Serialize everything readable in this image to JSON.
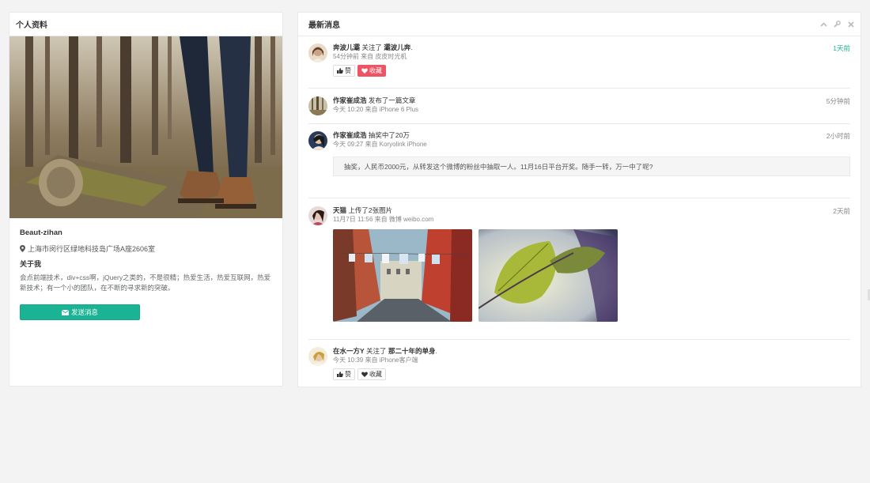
{
  "profile": {
    "title": "个人资料",
    "name": "Beaut-zihan",
    "address": "上海市闵行区绿地科技岛广场A座2606室",
    "about_title": "关于我",
    "about_text_1": "会点前端技术，div+css啊，jQuery之类的，不是很精；热爱生活，热爱互联网，热爱",
    "about_text_2": "新技术；有一个小的团队，在不断的寻求新的突破。",
    "send_label": "发送消息"
  },
  "feed": {
    "title": "最新消息",
    "items": [
      {
        "user": "奔波儿灞",
        "action": "关注了",
        "target": "灞波儿奔",
        "suffix": ".",
        "meta": "54分钟前 来自 皮皮时光机",
        "time": "1天前",
        "like_label": "赞",
        "fav_label": "收藏"
      },
      {
        "user": "作家崔成浩",
        "action": "发布了一篇文章",
        "meta": "今天 10:20 来自 iPhone 6 Plus",
        "time": "5分钟前"
      },
      {
        "user": "作家崔成浩",
        "action": "抽奖中了20万",
        "meta": "今天 09:27 来自 Koryolink iPhone",
        "time": "2小时前",
        "quote": "抽奖，人民币2000元，从转发这个微博的粉丝中抽取一人。11月16日平台开奖。随手一转，万一中了呢?"
      },
      {
        "user": "天猫",
        "action": "上传了2张图片",
        "meta": "11月7日 11:56 来自 微博 weibo.com",
        "time": "2天前"
      },
      {
        "user": "在水一方Y",
        "action": "关注了",
        "target": "那二十年的单身",
        "suffix": ".",
        "meta": "今天 10:39 来自 iPhone客户端",
        "like_label": "赞",
        "fav_label": "收藏"
      }
    ]
  },
  "colors": {
    "accent": "#1ab394",
    "danger": "#ed5565",
    "background": "#f3f3f4"
  },
  "icons": [
    "map-marker-icon",
    "envelope-icon",
    "chevron-up-icon",
    "wrench-icon",
    "close-icon",
    "thumbs-up-icon",
    "heart-icon"
  ]
}
